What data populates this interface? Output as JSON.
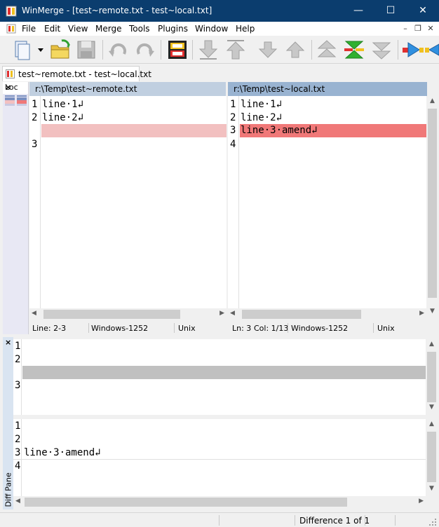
{
  "window": {
    "title": "WinMerge - [test~remote.txt - test~local.txt]",
    "minimize": "—",
    "maximize": "☐",
    "close": "✕"
  },
  "menu": {
    "items": [
      "File",
      "Edit",
      "View",
      "Merge",
      "Tools",
      "Plugins",
      "Window",
      "Help"
    ],
    "mdi_minimize": "–",
    "mdi_restore": "❐",
    "mdi_close": "✕"
  },
  "tab": {
    "label": "test~remote.txt - test~local.txt"
  },
  "location_pane": {
    "title": "Loc",
    "close": "×"
  },
  "left_pane": {
    "path": "r:\\Temp\\test~remote.txt",
    "lines": [
      {
        "num": "1",
        "text": "line·1↲"
      },
      {
        "num": "2",
        "text": "line·2↲"
      },
      {
        "num": "",
        "text": ""
      },
      {
        "num": "3",
        "text": ""
      }
    ],
    "status": {
      "line": "Line: 2-3",
      "encoding": "Windows-1252",
      "eol": "Unix"
    }
  },
  "right_pane": {
    "path": "r:\\Temp\\test~local.txt",
    "lines": [
      {
        "num": "1",
        "text": "line·1↲"
      },
      {
        "num": "2",
        "text": "line·2↲"
      },
      {
        "num": "3",
        "text": "line·3·amend↲"
      },
      {
        "num": "4",
        "text": ""
      }
    ],
    "status": {
      "line": "Ln: 3",
      "col": "Col: 1/13",
      "encoding": "Windows-1252",
      "eol": "Unix"
    }
  },
  "diff_pane": {
    "title": "Diff Pane",
    "close": "×",
    "top_lines": [
      {
        "num": "1",
        "text": ""
      },
      {
        "num": "2",
        "text": ""
      },
      {
        "num": "",
        "text": ""
      },
      {
        "num": "3",
        "text": ""
      }
    ],
    "bottom_lines": [
      {
        "num": "1",
        "text": ""
      },
      {
        "num": "2",
        "text": ""
      },
      {
        "num": "3",
        "text": "line·3·amend↲"
      },
      {
        "num": "4",
        "text": ""
      }
    ]
  },
  "statusbar": {
    "difference": "Difference 1 of 1"
  },
  "colors": {
    "titlebar": "#0b3d6e",
    "left_header": "#c0cfe0",
    "right_header": "#99b3d1",
    "diff_ghost": "#f2c0c0",
    "diff_highlight": "#f07878",
    "diffpane_ghost": "#c0c0c0"
  }
}
